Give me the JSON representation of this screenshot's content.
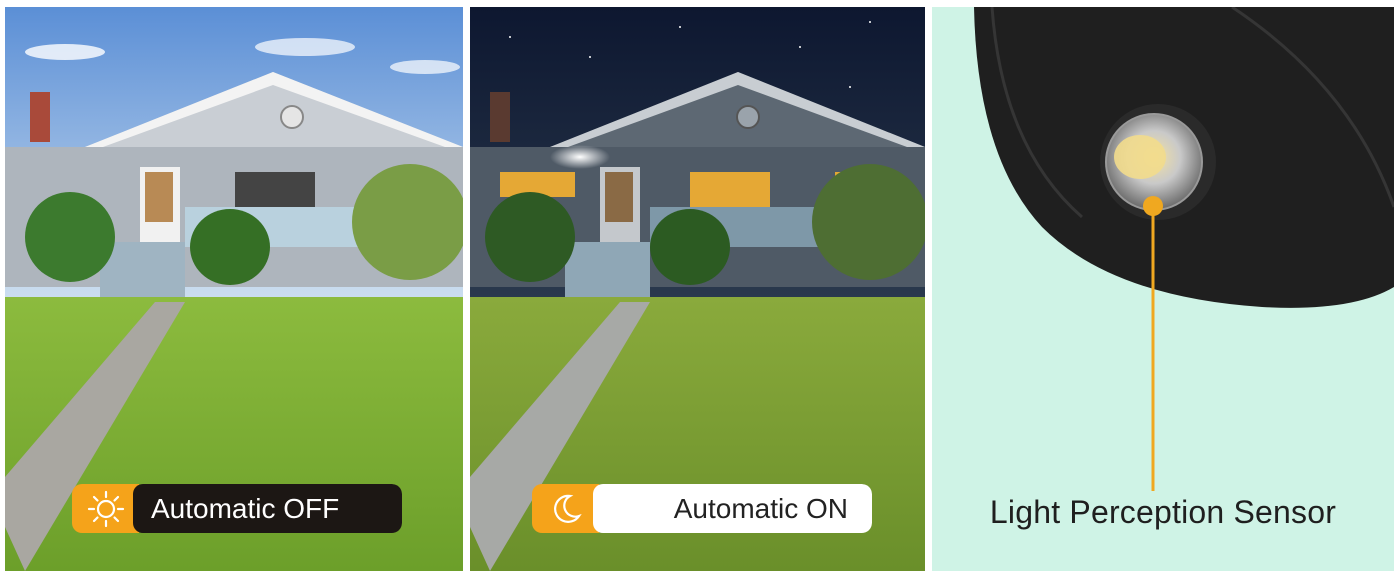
{
  "panels": {
    "day": {
      "badge_label": "Automatic OFF",
      "badge_icon": "sun-icon",
      "colors": {
        "badge_icon_bg": "#f5a31a",
        "badge_text_bg": "#1c1714",
        "badge_text": "#ffffff"
      }
    },
    "night": {
      "badge_label": "Automatic ON",
      "badge_icon": "moon-icon",
      "colors": {
        "badge_icon_bg": "#f5a31a",
        "badge_text_bg": "#ffffff",
        "badge_text": "#222222"
      }
    },
    "sensor": {
      "caption": "Light Perception Sensor",
      "colors": {
        "background": "#cff3e6",
        "pointer": "#f0a820",
        "device": "#1f1f1f"
      }
    }
  }
}
